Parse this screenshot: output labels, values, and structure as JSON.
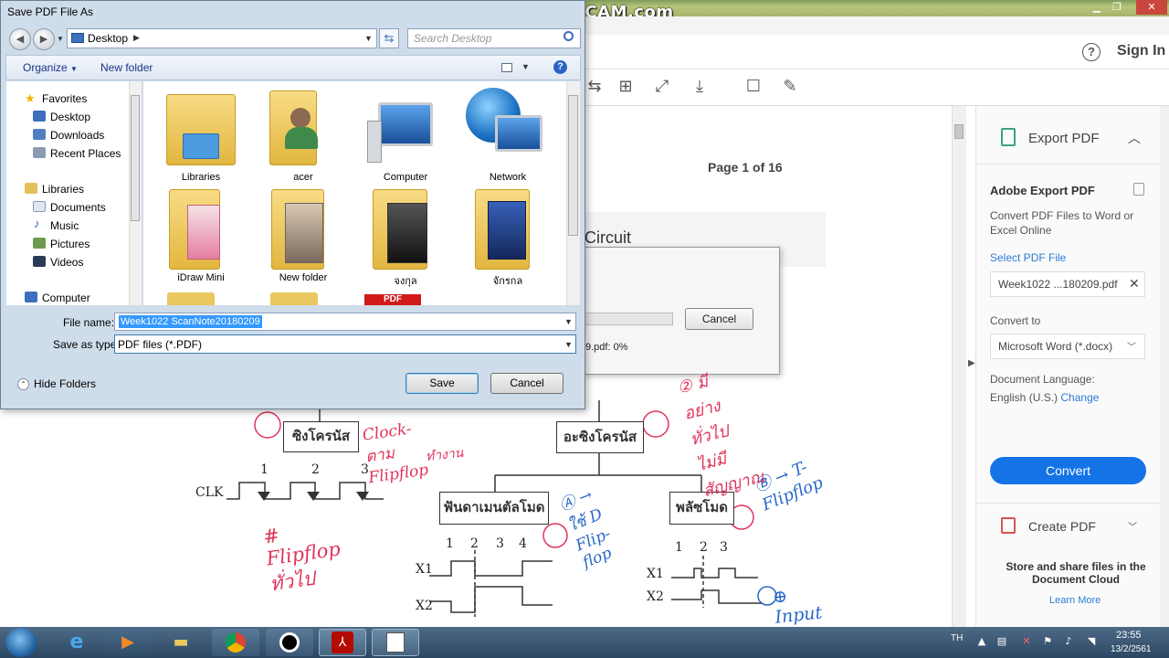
{
  "watermark": "www.BANDICAM.com",
  "window_controls": {
    "minimize": "▁",
    "restore": "❐",
    "close": "✕"
  },
  "acrobat": {
    "help_label": "?",
    "sign_in": "Sign In",
    "page_label": "Page 1 of 16",
    "doc_heading_fragment": "Circuit",
    "progress": {
      "cancel_label": "Cancel",
      "status_text": "9.pdf: 0%",
      "percent": 0
    },
    "right_panel": {
      "export_title": "Export PDF",
      "adobe_export": "Adobe Export PDF",
      "convert_desc": "Convert PDF Files to Word or Excel Online",
      "select_pdf": "Select PDF File",
      "selected_file": "Week1022 ...180209.pdf",
      "convert_to_label": "Convert to",
      "format_value": "Microsoft Word (*.docx)",
      "doc_language_label": "Document Language:",
      "language_value": "English (U.S.)",
      "language_change": "Change",
      "convert_button": "Convert",
      "create_title": "Create PDF",
      "store_text": "Store and share files in the Document Cloud",
      "learn_more": "Learn More"
    },
    "diagram": {
      "box_sync": "ซิงโครนัส",
      "box_async": "อะซิงโครนัส",
      "box_fundamental": "ฟันดาเมนตัลโมด",
      "box_pulse": "พลัซโมด",
      "clk": "CLK",
      "ticks": [
        "1",
        "2",
        "3"
      ],
      "ticks_fund": [
        "1",
        "2",
        "3",
        "4"
      ],
      "ticks_pulse": [
        "1",
        "2",
        "3"
      ],
      "x1": "X1",
      "x2": "X2",
      "hw_clock": "Clock-ตาม Flipflop",
      "hw_flipflop_note": "# Flipflop ทั่วไป",
      "hw_normal": "ทำงาน",
      "hw_no_clock": "② มีอย่าง ทั่วไป ไม่มีสัญญาณ",
      "hw_dflip": "Ⓐ → ใช้ D Flip-flop",
      "hw_tflip": "Ⓑ → T-Flipflop",
      "hw_input": "⊕ Input ทั่วไป pulse"
    }
  },
  "save_dialog": {
    "title": "Save PDF File As",
    "address": "Desktop",
    "search_placeholder": "Search Desktop",
    "organize": "Organize",
    "new_folder": "New folder",
    "nav": {
      "favorites": "Favorites",
      "desktop": "Desktop",
      "downloads": "Downloads",
      "recent_places": "Recent Places",
      "libraries": "Libraries",
      "documents": "Documents",
      "music": "Music",
      "pictures": "Pictures",
      "videos": "Videos",
      "computer": "Computer"
    },
    "files": [
      "Libraries",
      "acer",
      "Computer",
      "Network",
      "iDraw Mini",
      "New folder",
      "จงกุล",
      "จักรกล"
    ],
    "partial_file_badge": "PDF",
    "file_name_label": "File name:",
    "file_name_value": "Week1022 ScanNote20180209",
    "save_as_type_label": "Save as type:",
    "save_as_type_value": "PDF files (*.PDF)",
    "hide_folders": "Hide Folders",
    "save_button": "Save",
    "cancel_button": "Cancel"
  },
  "taskbar": {
    "language": "TH",
    "time": "23:55",
    "date": "13/2/2561"
  }
}
